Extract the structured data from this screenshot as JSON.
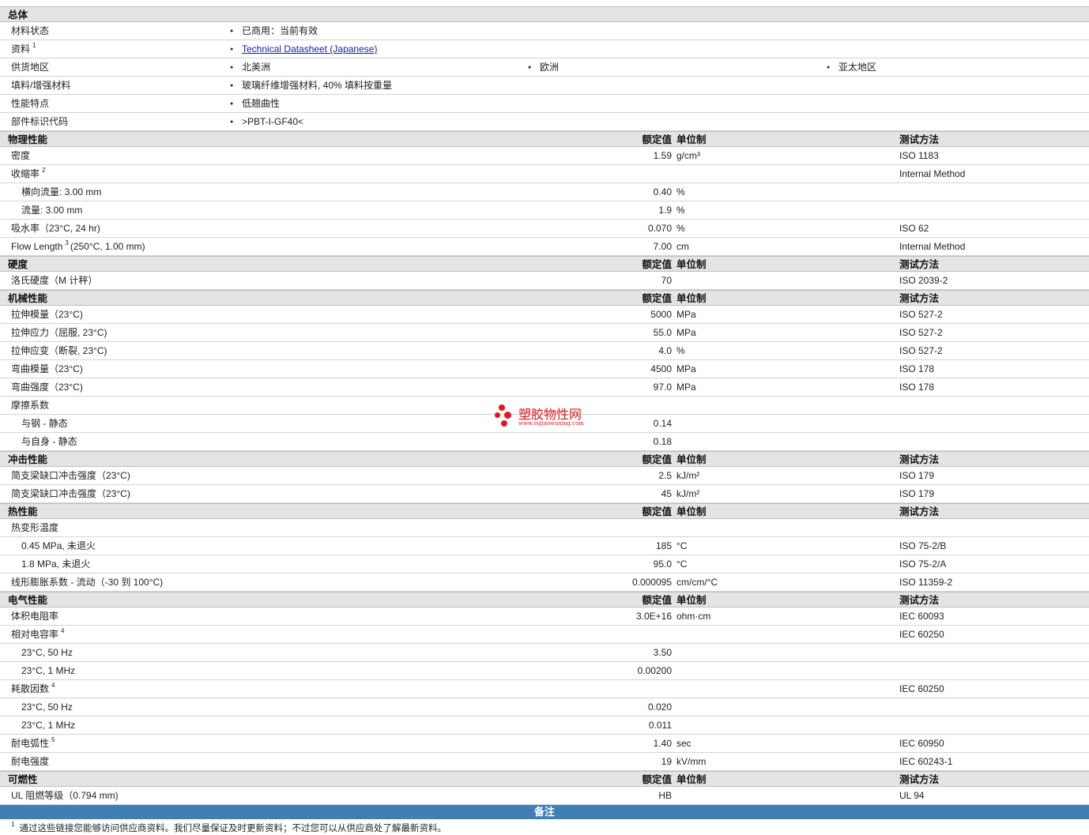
{
  "general": {
    "title": "总体",
    "rows": [
      {
        "label": "材料状态",
        "sup": "",
        "items": [
          "已商用：当前有效"
        ]
      },
      {
        "label": "资料",
        "sup": "1",
        "items": [
          "Technical Datasheet (Japanese)"
        ]
      },
      {
        "label": "供货地区",
        "sup": "",
        "items": [
          "北美洲",
          "欧洲",
          "亚太地区"
        ]
      },
      {
        "label": "填料/增强材料",
        "sup": "",
        "items": [
          "玻璃纤维增强材料, 40% 填料按重量"
        ]
      },
      {
        "label": "性能特点",
        "sup": "",
        "items": [
          "低翘曲性"
        ]
      },
      {
        "label": "部件标识代码",
        "sup": "",
        "items": [
          ">PBT-I-GF40<"
        ]
      }
    ]
  },
  "col_headers": {
    "value": "额定值",
    "unit": "单位制",
    "method": "测试方法"
  },
  "sections": [
    {
      "title": "物理性能",
      "rows": [
        {
          "label": "密度",
          "sup": "",
          "sub": false,
          "value": "1.59",
          "unit": "g/cm³",
          "method": "ISO 1183"
        },
        {
          "label": "收缩率",
          "sup": "2",
          "sub": false,
          "value": "",
          "unit": "",
          "method": "Internal Method"
        },
        {
          "label": "横向流量: 3.00 mm",
          "sup": "",
          "sub": true,
          "value": "0.40",
          "unit": "%",
          "method": ""
        },
        {
          "label": "流量: 3.00 mm",
          "sup": "",
          "sub": true,
          "value": "1.9",
          "unit": "%",
          "method": ""
        },
        {
          "label": "吸水率（23°C, 24 hr)",
          "sup": "",
          "sub": false,
          "value": "0.070",
          "unit": "%",
          "method": "ISO 62"
        },
        {
          "label": "Flow Length",
          "sup": "3",
          "after": "(250°C, 1.00 mm)",
          "sub": false,
          "value": "7.00",
          "unit": "cm",
          "method": "Internal Method"
        }
      ]
    },
    {
      "title": "硬度",
      "rows": [
        {
          "label": "洛氏硬度（M 计秤）",
          "sup": "",
          "sub": false,
          "value": "70",
          "unit": "",
          "method": "ISO 2039-2"
        }
      ]
    },
    {
      "title": "机械性能",
      "rows": [
        {
          "label": "拉伸模量（23°C)",
          "sup": "",
          "sub": false,
          "value": "5000",
          "unit": "MPa",
          "method": "ISO 527-2"
        },
        {
          "label": "拉伸应力（屈服, 23°C)",
          "sup": "",
          "sub": false,
          "value": "55.0",
          "unit": "MPa",
          "method": "ISO 527-2"
        },
        {
          "label": "拉伸应变（断裂, 23°C)",
          "sup": "",
          "sub": false,
          "value": "4.0",
          "unit": "%",
          "method": "ISO 527-2"
        },
        {
          "label": "弯曲模量（23°C)",
          "sup": "",
          "sub": false,
          "value": "4500",
          "unit": "MPa",
          "method": "ISO 178"
        },
        {
          "label": "弯曲强度（23°C)",
          "sup": "",
          "sub": false,
          "value": "97.0",
          "unit": "MPa",
          "method": "ISO 178"
        },
        {
          "label": "摩擦系数",
          "sup": "",
          "sub": false,
          "value": "",
          "unit": "",
          "method": ""
        },
        {
          "label": "与钢 - 静态",
          "sup": "",
          "sub": true,
          "value": "0.14",
          "unit": "",
          "method": ""
        },
        {
          "label": "与自身 - 静态",
          "sup": "",
          "sub": true,
          "value": "0.18",
          "unit": "",
          "method": ""
        }
      ]
    },
    {
      "title": "冲击性能",
      "rows": [
        {
          "label": "简支梁缺口冲击强度（23°C)",
          "sup": "",
          "sub": false,
          "value": "2.5",
          "unit": "kJ/m²",
          "method": "ISO 179"
        },
        {
          "label": "简支梁缺口冲击强度（23°C)",
          "sup": "",
          "sub": false,
          "value": "45",
          "unit": "kJ/m²",
          "method": "ISO 179"
        }
      ]
    },
    {
      "title": "热性能",
      "rows": [
        {
          "label": "热变形温度",
          "sup": "",
          "sub": false,
          "value": "",
          "unit": "",
          "method": ""
        },
        {
          "label": "0.45 MPa, 未退火",
          "sup": "",
          "sub": true,
          "value": "185",
          "unit": "°C",
          "method": "ISO 75-2/B"
        },
        {
          "label": "1.8 MPa, 未退火",
          "sup": "",
          "sub": true,
          "value": "95.0",
          "unit": "°C",
          "method": "ISO 75-2/A"
        },
        {
          "label": "线形膨胀系数 - 流动（-30 到 100°C)",
          "sup": "",
          "sub": false,
          "value": "0.000095",
          "unit": "cm/cm/°C",
          "method": "ISO 11359-2"
        }
      ]
    },
    {
      "title": "电气性能",
      "rows": [
        {
          "label": "体积电阻率",
          "sup": "",
          "sub": false,
          "value": "3.0E+16",
          "unit": "ohm·cm",
          "method": "IEC 60093"
        },
        {
          "label": "相对电容率",
          "sup": "4",
          "sub": false,
          "value": "",
          "unit": "",
          "method": "IEC 60250"
        },
        {
          "label": "23°C, 50 Hz",
          "sup": "",
          "sub": true,
          "value": "3.50",
          "unit": "",
          "method": ""
        },
        {
          "label": "23°C, 1 MHz",
          "sup": "",
          "sub": true,
          "value": "0.00200",
          "unit": "",
          "method": ""
        },
        {
          "label": "耗散因数",
          "sup": "4",
          "sub": false,
          "value": "",
          "unit": "",
          "method": "IEC 60250"
        },
        {
          "label": "23°C, 50 Hz",
          "sup": "",
          "sub": true,
          "value": "0.020",
          "unit": "",
          "method": ""
        },
        {
          "label": "23°C, 1 MHz",
          "sup": "",
          "sub": true,
          "value": "0.011",
          "unit": "",
          "method": ""
        },
        {
          "label": "耐电弧性",
          "sup": "5",
          "sub": false,
          "value": "1.40",
          "unit": "sec",
          "method": "IEC 60950"
        },
        {
          "label": "耐电强度",
          "sup": "",
          "sub": false,
          "value": "19",
          "unit": "kV/mm",
          "method": "IEC 60243-1"
        }
      ]
    },
    {
      "title": "可燃性",
      "rows": [
        {
          "label": "UL 阻燃等级（0.794 mm)",
          "sup": "",
          "sub": false,
          "value": "HB",
          "unit": "",
          "method": "UL 94"
        }
      ]
    }
  ],
  "notes": {
    "title": "备注",
    "footnote_num": "1",
    "footnote_text": "通过这些链接您能够访问供应商资料。我们尽量保证及时更新资料；不过您可以从供应商处了解最新资料。"
  },
  "watermark": {
    "text": "塑胶物性网",
    "url": "www.sujiaowuxing.com",
    "color": "#e3171b"
  }
}
